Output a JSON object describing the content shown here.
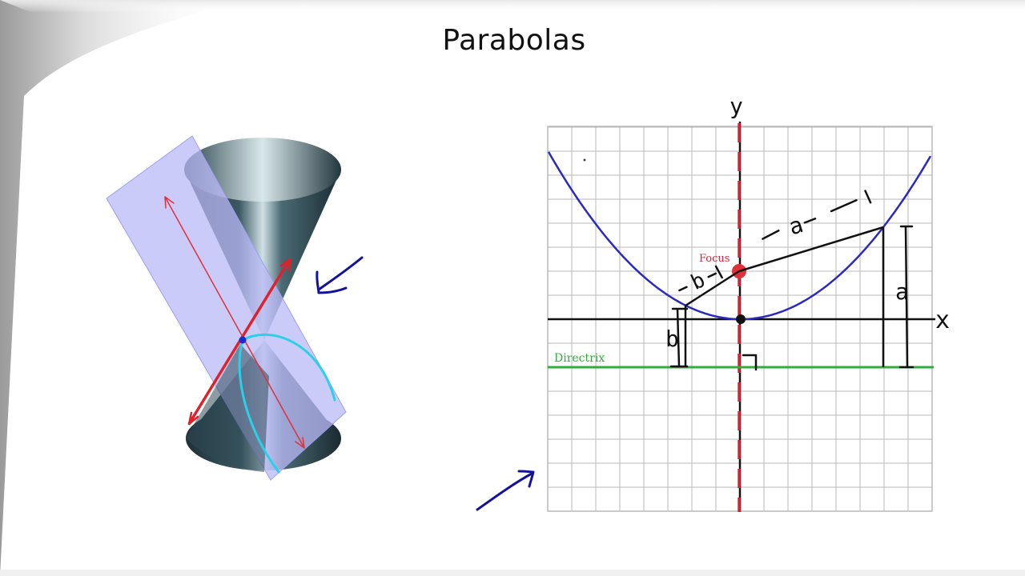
{
  "slide": {
    "title": "Parabolas"
  },
  "graph": {
    "x_axis_label": "x",
    "y_axis_label": "y",
    "focus_label": "Focus",
    "directrix_label": "Directrix",
    "distance_a_label": "a",
    "distance_b_label": "b",
    "segment_b_annotation": "b",
    "segment_a_annotation": "a"
  },
  "colors": {
    "parabola": "#2a2abf",
    "focus": "#e0303a",
    "directrix": "#2fae3a",
    "axis_of_symmetry": "#d8243a",
    "grid": "#b9b9b9",
    "ink": "#0d0d8a",
    "plane": "#b9b9f7",
    "cone": "#2f4c56",
    "section_curve": "#2ad0e8"
  },
  "cone_figure": {
    "description_icon": "double-cone-icon"
  }
}
